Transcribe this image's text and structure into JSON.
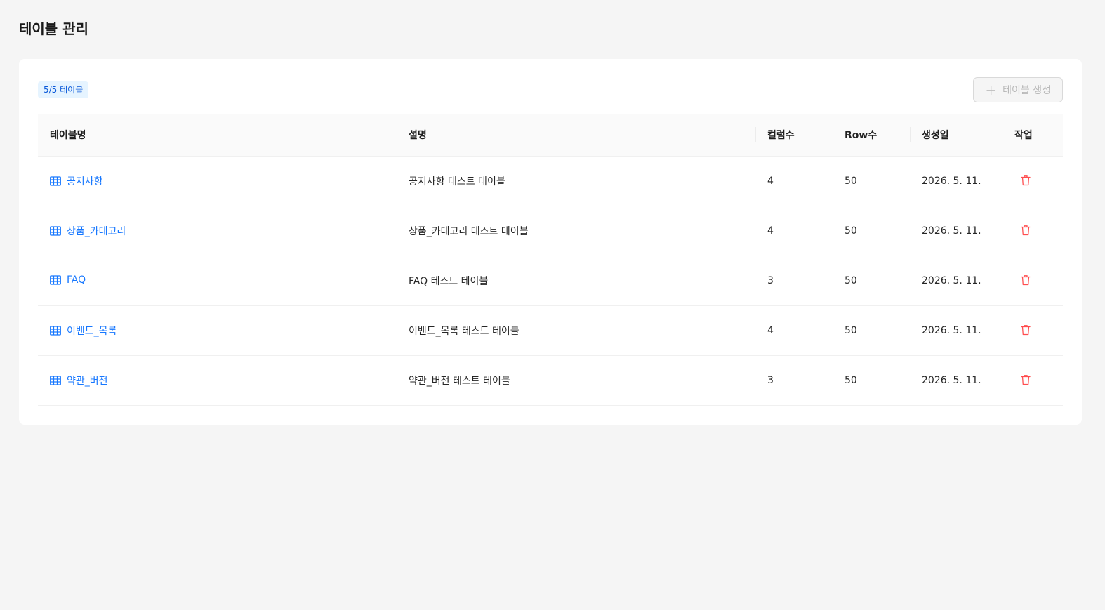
{
  "page": {
    "title": "테이블 관리"
  },
  "toolbar": {
    "count_label": "5/5 테이블",
    "create_label": "테이블 생성",
    "create_icon": "plus-icon"
  },
  "columns": [
    "테이블명",
    "설명",
    "컬럼수",
    "Row수",
    "생성일",
    "작업"
  ],
  "rows": [
    {
      "name": "공지사항",
      "description": "공지사항 테스트 테이블",
      "columns": "4",
      "rows": "50",
      "created": "2026. 5. 11."
    },
    {
      "name": "상품_카테고리",
      "description": "상품_카테고리 테스트 테이블",
      "columns": "4",
      "rows": "50",
      "created": "2026. 5. 11."
    },
    {
      "name": "FAQ",
      "description": "FAQ 테스트 테이블",
      "columns": "3",
      "rows": "50",
      "created": "2026. 5. 11."
    },
    {
      "name": "이벤트_목록",
      "description": "이벤트_목록 테스트 테이블",
      "columns": "4",
      "rows": "50",
      "created": "2026. 5. 11."
    },
    {
      "name": "약관_버전",
      "description": "약관_버전 테스트 테이블",
      "columns": "3",
      "rows": "50",
      "created": "2026. 5. 11."
    }
  ],
  "colors": {
    "accent": "#1677ff",
    "delete": "#ff4d4f",
    "badge_bg": "#e6f4ff",
    "badge_text": "#0958d9"
  },
  "icons": {
    "table": "table-icon",
    "delete": "trash-icon"
  }
}
